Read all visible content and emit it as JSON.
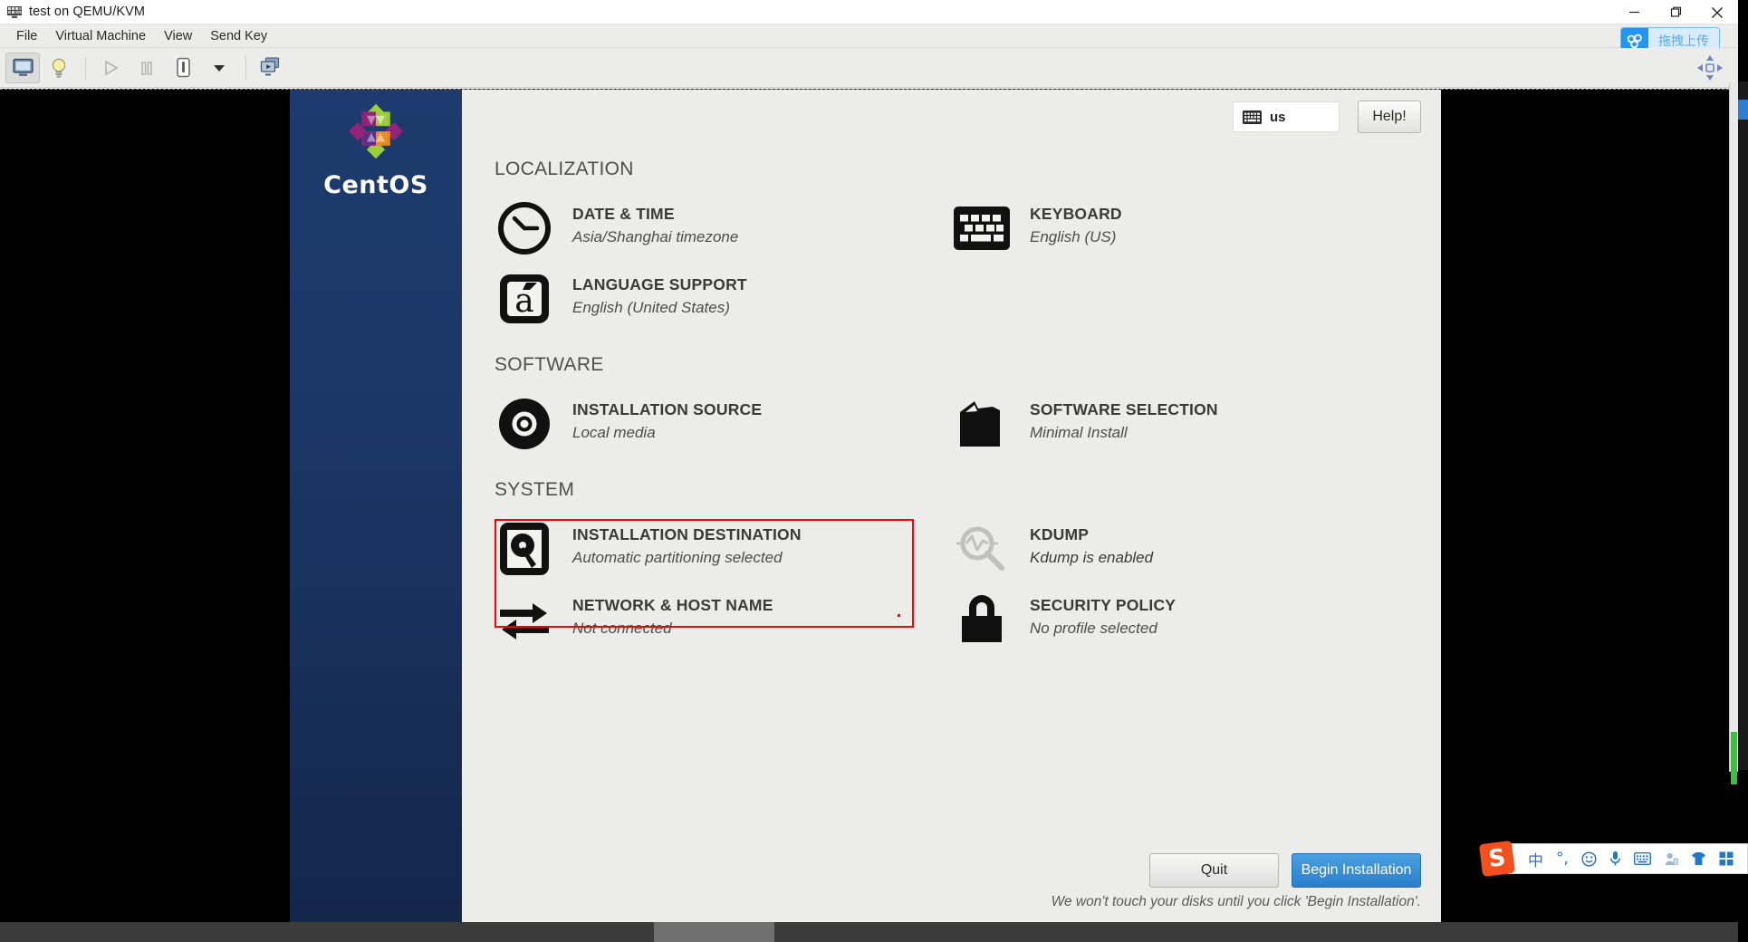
{
  "window": {
    "title": "test on QEMU/KVM",
    "title_icon": "vm-icon",
    "controls": [
      {
        "name": "minimize",
        "glyph": "–"
      },
      {
        "name": "maximize",
        "glyph": "❐"
      },
      {
        "name": "close",
        "glyph": "✕"
      }
    ]
  },
  "menubar": {
    "items": [
      {
        "label": "File"
      },
      {
        "label": "Virtual Machine"
      },
      {
        "label": "View"
      },
      {
        "label": "Send Key"
      }
    ]
  },
  "upload_badge": {
    "label": "拖拽上传",
    "icon": "cloud-upload-icon",
    "accent": "#2196f3",
    "bg": "#d9ecfb"
  },
  "toolbar": {
    "buttons": [
      {
        "name": "console-view",
        "icon": "monitor-icon",
        "active": true
      },
      {
        "name": "show-details",
        "icon": "lightbulb-icon",
        "active": false
      },
      {
        "name": "run",
        "icon": "play-icon",
        "active": false,
        "disabled": true
      },
      {
        "name": "pause",
        "icon": "pause-icon",
        "active": false,
        "disabled": true
      },
      {
        "name": "shutdown",
        "icon": "power-icon",
        "active": false
      },
      {
        "name": "shutdown-menu",
        "icon": "chevron-down-icon",
        "active": false
      },
      {
        "name": "fullscreen",
        "icon": "screens-icon",
        "active": false
      }
    ],
    "right_icon": "move-resize-icon"
  },
  "anaconda": {
    "brand": {
      "name": "CentOS",
      "logo": "centos-flower-logo"
    },
    "keyboard_indicator": {
      "icon": "keyboard-icon",
      "label": "us"
    },
    "help_button": "Help!",
    "sections": [
      {
        "title": "LOCALIZATION",
        "items": [
          {
            "icon": "clock-icon",
            "title": "DATE & TIME",
            "subtitle": "Asia/Shanghai timezone",
            "column": 0
          },
          {
            "icon": "keyboard-icon",
            "title": "KEYBOARD",
            "subtitle": "English (US)",
            "column": 1
          },
          {
            "icon": "language-icon",
            "title": "LANGUAGE SUPPORT",
            "subtitle": "English (United States)",
            "column": 0
          }
        ]
      },
      {
        "title": "SOFTWARE",
        "items": [
          {
            "icon": "disc-icon",
            "title": "INSTALLATION SOURCE",
            "subtitle": "Local media",
            "column": 0
          },
          {
            "icon": "package-icon",
            "title": "SOFTWARE SELECTION",
            "subtitle": "Minimal Install",
            "column": 1
          }
        ]
      },
      {
        "title": "SYSTEM",
        "items": [
          {
            "icon": "harddrive-icon",
            "title": "INSTALLATION DESTINATION",
            "subtitle": "Automatic partitioning selected",
            "column": 0,
            "highlighted": true
          },
          {
            "icon": "kdump-icon",
            "title": "KDUMP",
            "subtitle": "Kdump is enabled",
            "column": 1,
            "dimmed": true
          },
          {
            "icon": "network-icon",
            "title": "NETWORK & HOST NAME",
            "subtitle": "Not connected",
            "column": 0
          },
          {
            "icon": "lock-icon",
            "title": "SECURITY POLICY",
            "subtitle": "No profile selected",
            "column": 1
          }
        ]
      }
    ],
    "footer": {
      "quit_label": "Quit",
      "begin_label": "Begin Installation",
      "warning": "We won't touch your disks until you click 'Begin Installation'.",
      "accent": "#2a80cc"
    },
    "annotation": {
      "color": "#ff0000",
      "target": "INSTALLATION DESTINATION"
    }
  },
  "ime_bar": {
    "logo": "S",
    "icons": [
      {
        "name": "chinese-mode-icon",
        "glyph": "中"
      },
      {
        "name": "punctuation-icon",
        "glyph": "°,"
      },
      {
        "name": "emoji-icon",
        "glyph": "☺"
      },
      {
        "name": "voice-input-icon",
        "glyph": "⏺"
      },
      {
        "name": "soft-keyboard-icon",
        "glyph": "⌨"
      },
      {
        "name": "user-icon",
        "glyph": "◔"
      },
      {
        "name": "skin-icon",
        "glyph": "▲"
      },
      {
        "name": "toolbox-icon",
        "glyph": "⊞"
      }
    ]
  }
}
